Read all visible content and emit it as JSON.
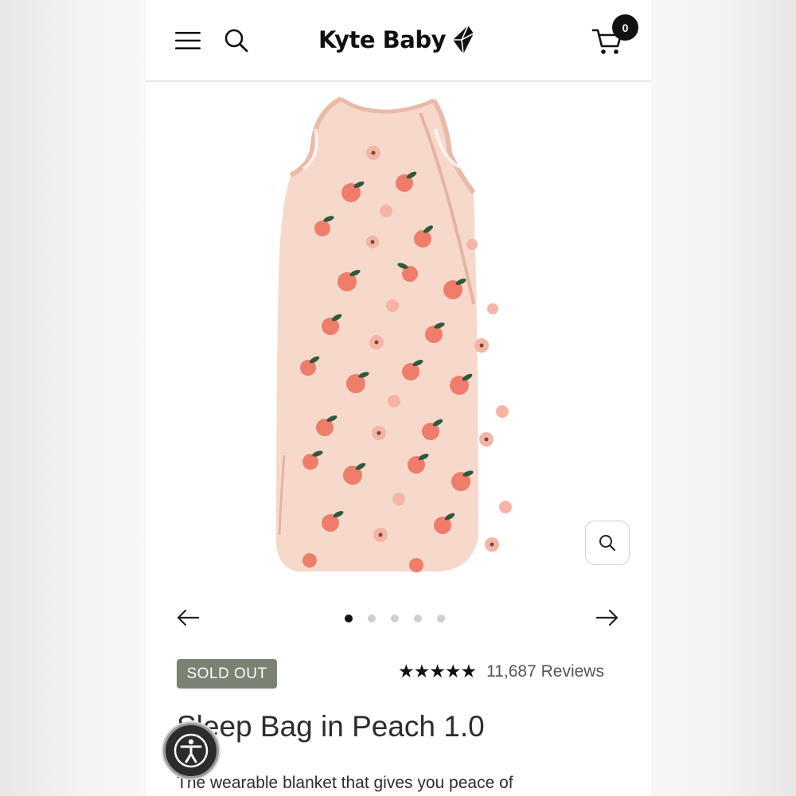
{
  "header": {
    "brand_name": "Kyte Baby",
    "cart_count": "0"
  },
  "icons": {
    "menu": "hamburger-menu-icon",
    "search": "search-icon",
    "cart": "cart-icon",
    "zoom": "zoom-magnifier-icon",
    "prev": "arrow-left-icon",
    "next": "arrow-right-icon",
    "accessibility": "accessibility-icon",
    "logo_mark": "kite-logo-icon"
  },
  "gallery": {
    "slide_count": 5,
    "active_slide": 1
  },
  "product": {
    "badge": "SOLD OUT",
    "stars": "★★★★★",
    "rating_value": 5,
    "reviews": "11,687 Reviews",
    "title": "Sleep Bag in Peach 1.0",
    "description": "The wearable blanket that gives you peace of"
  },
  "colors": {
    "badge_bg": "#7b8273",
    "fabric": "#f7d9cc",
    "peach": "#ef7d6a",
    "leaf": "#2f5a3a"
  }
}
